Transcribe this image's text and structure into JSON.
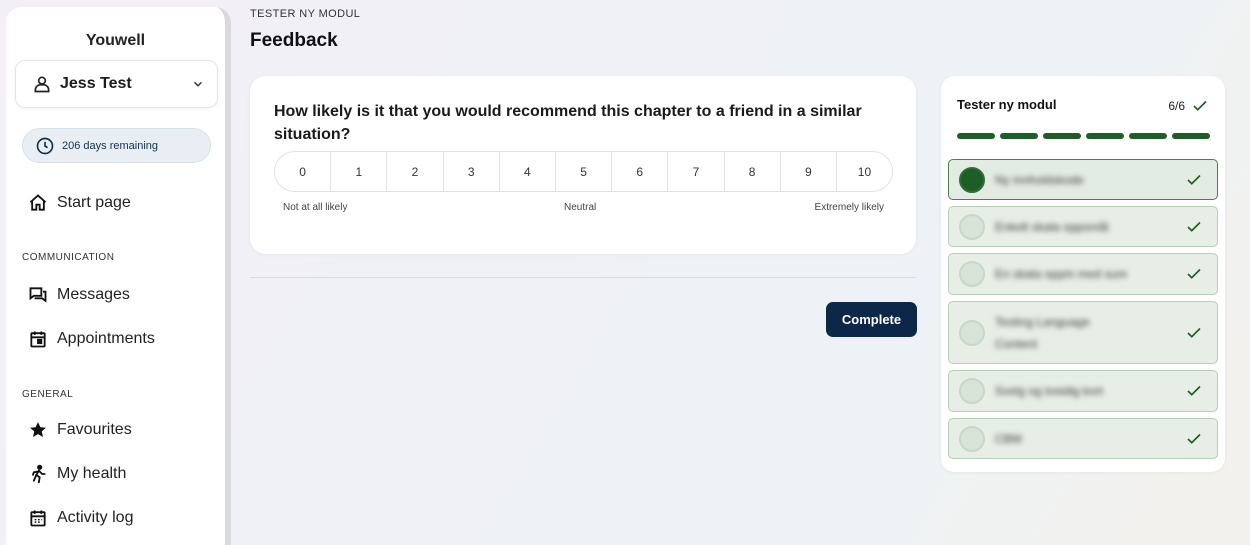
{
  "sidebar": {
    "brand": "Youwell",
    "user": "Jess Test",
    "days_remaining": "206 days remaining",
    "start_page": "Start page",
    "sections": {
      "communication": "COMMUNICATION",
      "general": "GENERAL"
    },
    "items": {
      "messages": "Messages",
      "appointments": "Appointments",
      "favourites": "Favourites",
      "my_health": "My health",
      "activity_log": "Activity log"
    }
  },
  "header": {
    "breadcrumb": "TESTER NY MODUL",
    "title": "Feedback"
  },
  "question": {
    "text": "How likely is it that you would recommend this chapter to a friend in a similar situation?",
    "scale": [
      "0",
      "1",
      "2",
      "3",
      "4",
      "5",
      "6",
      "7",
      "8",
      "9",
      "10"
    ],
    "label_low": "Not at all likely",
    "label_mid": "Neutral",
    "label_high": "Extremely likely"
  },
  "complete_label": "Complete",
  "progress": {
    "title": "Tester ny modul",
    "count": "6/6",
    "completed_fraction": 1.0,
    "steps": [
      {
        "label": "Ny innholdskode"
      },
      {
        "label": "Enkelt skala oppsmål"
      },
      {
        "label": "En skala oppm med sum"
      },
      {
        "label": "Testing Language Content"
      },
      {
        "label": "Svelg og tosidig kort"
      },
      {
        "label": "CBM"
      }
    ]
  },
  "colors": {
    "primary": "#0c2747",
    "success": "#1e5d25",
    "step_bg": "#e6eee5"
  }
}
